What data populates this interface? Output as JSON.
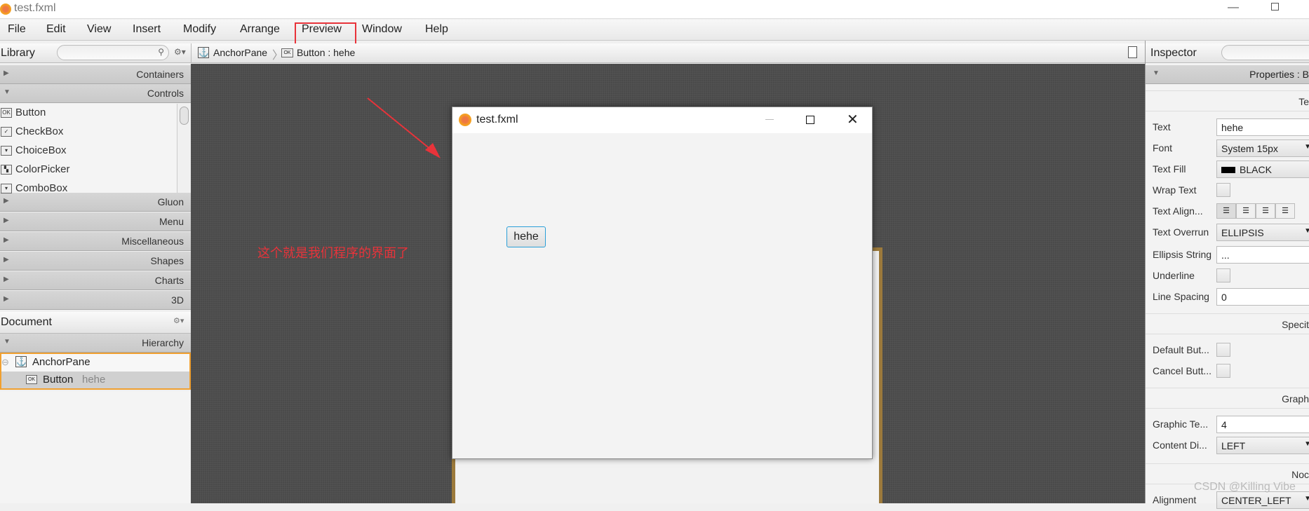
{
  "window": {
    "title": "test.fxml"
  },
  "menu": [
    "File",
    "Edit",
    "View",
    "Insert",
    "Modify",
    "Arrange",
    "Preview",
    "Window",
    "Help"
  ],
  "library": {
    "title": "Library",
    "sections_top": [
      "Containers",
      "Controls"
    ],
    "controls": [
      {
        "icon": "ok-button-icon",
        "label": "Button"
      },
      {
        "icon": "checkbox-icon",
        "label": "CheckBox"
      },
      {
        "icon": "choicebox-icon",
        "label": "ChoiceBox"
      },
      {
        "icon": "colorpicker-icon",
        "label": "ColorPicker"
      },
      {
        "icon": "combobox-icon",
        "label": "ComboBox"
      }
    ],
    "sections_bottom": [
      "Gluon",
      "Menu",
      "Miscellaneous",
      "Shapes",
      "Charts",
      "3D"
    ]
  },
  "document": {
    "title": "Document",
    "section": "Hierarchy",
    "tree": [
      {
        "label": "AnchorPane"
      },
      {
        "label": "Button",
        "detail": "hehe"
      }
    ]
  },
  "breadcrumb": [
    {
      "label": "AnchorPane"
    },
    {
      "label": "Button : hehe"
    }
  ],
  "preview": {
    "title": "test.fxml",
    "button": "hehe"
  },
  "annotation": {
    "text": "这个就是我们程序的界面了",
    "color": "#e8333a"
  },
  "inspector": {
    "title": "Inspector",
    "section": "Properties : B",
    "groups": [
      {
        "title": "Te",
        "rows": [
          {
            "label": "Text",
            "type": "text",
            "value": "hehe"
          },
          {
            "label": "Font",
            "type": "select",
            "value": "System 15px"
          },
          {
            "label": "Text Fill",
            "type": "color",
            "value": "BLACK"
          },
          {
            "label": "Wrap Text",
            "type": "check"
          },
          {
            "label": "Text Align...",
            "type": "align"
          },
          {
            "label": "Text Overrun",
            "type": "select",
            "value": "ELLIPSIS"
          },
          {
            "label": "Ellipsis String",
            "type": "text",
            "value": "..."
          },
          {
            "label": "Underline",
            "type": "check"
          },
          {
            "label": "Line Spacing",
            "type": "text",
            "value": "0"
          }
        ]
      },
      {
        "title": "Specit",
        "rows": [
          {
            "label": "Default But...",
            "type": "check"
          },
          {
            "label": "Cancel Butt...",
            "type": "check"
          }
        ]
      },
      {
        "title": "Graph",
        "rows": [
          {
            "label": "Graphic Te...",
            "type": "text",
            "value": "4"
          },
          {
            "label": "Content Di...",
            "type": "select",
            "value": "LEFT"
          }
        ]
      },
      {
        "title": "Noc",
        "rows": [
          {
            "label": "Alignment",
            "type": "select",
            "value": "CENTER_LEFT"
          }
        ]
      }
    ]
  },
  "watermark": "CSDN @Killing Vibe"
}
